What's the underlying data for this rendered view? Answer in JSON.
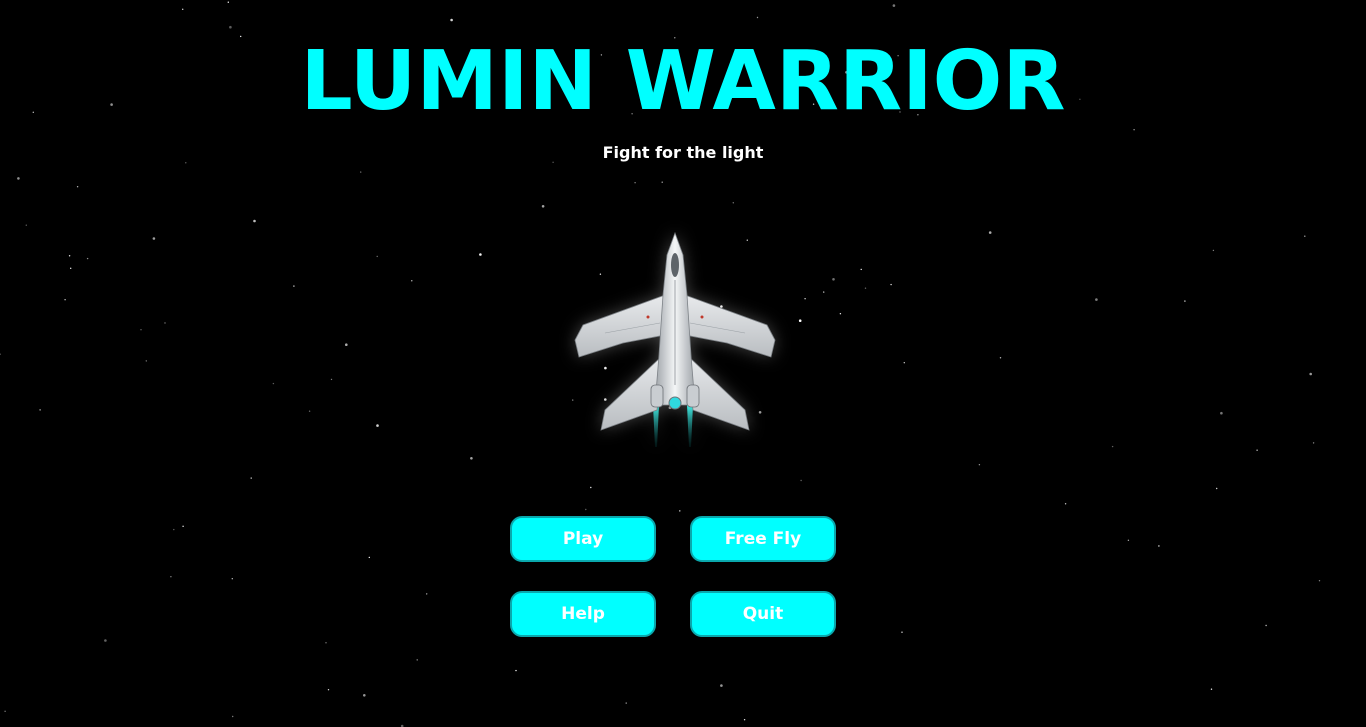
{
  "title": "LUMIN WARRIOR",
  "subtitle": "Fight for the light",
  "colors": {
    "accent": "#00ffff",
    "background": "#000000",
    "button_text": "#ffffff",
    "button_border": "#0aa8ad"
  },
  "ship": {
    "icon": "spaceship-icon"
  },
  "menu": {
    "play_label": "Play",
    "free_fly_label": "Free Fly",
    "help_label": "Help",
    "quit_label": "Quit"
  }
}
